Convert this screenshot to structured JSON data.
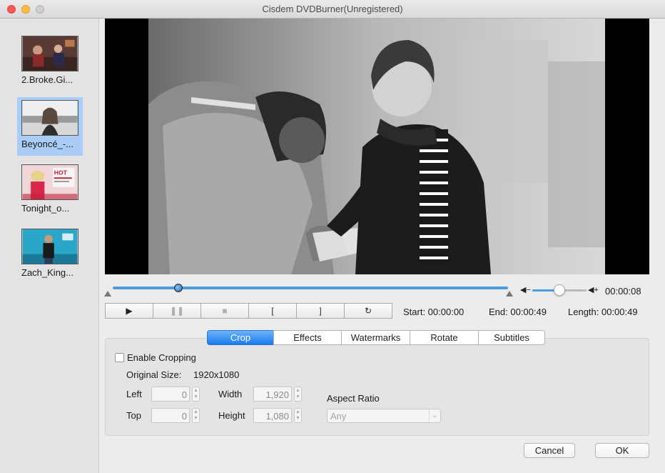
{
  "window": {
    "title": "Cisdem DVDBurner(Unregistered)"
  },
  "clips": [
    {
      "name": "2.Broke.Gi...",
      "selected": false
    },
    {
      "name": "Beyoncé_-...",
      "selected": true
    },
    {
      "name": "Tonight_o...",
      "selected": false
    },
    {
      "name": "Zach_King...",
      "selected": false
    }
  ],
  "playback": {
    "current_time": "00:00:08",
    "start_label": "Start: 00:00:00",
    "end_label": "End: 00:00:49",
    "length_label": "Length: 00:00:49",
    "progress": 0.17,
    "volume": 0.45
  },
  "controls": {
    "play": "▶",
    "pause": "❚❚",
    "stop": "■",
    "mark_in": "[",
    "mark_out": "]",
    "reset": "↻"
  },
  "tabs": [
    "Crop",
    "Effects",
    "Watermarks",
    "Rotate",
    "Subtitles"
  ],
  "active_tab": "Crop",
  "crop": {
    "enable_label": "Enable Cropping",
    "enabled": false,
    "original_size_label": "Original Size:",
    "original_size_value": "1920x1080",
    "left_label": "Left",
    "left_value": "0",
    "top_label": "Top",
    "top_value": "0",
    "width_label": "Width",
    "width_value": "1,920",
    "height_label": "Height",
    "height_value": "1,080",
    "aspect_label": "Aspect Ratio",
    "aspect_value": "Any"
  },
  "buttons": {
    "cancel": "Cancel",
    "ok": "OK"
  },
  "colors": {
    "accent": "#1b7cf0",
    "selection": "#a9cdf5"
  }
}
